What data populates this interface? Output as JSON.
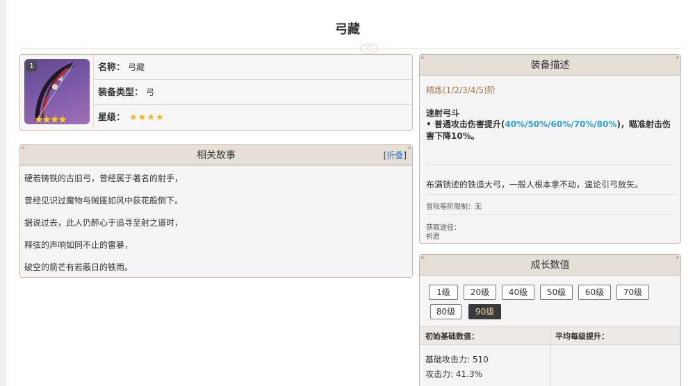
{
  "page": {
    "title": "弓藏"
  },
  "info": {
    "refine_badge": "1",
    "name_label": "名称：",
    "name_value": "弓藏",
    "type_label": "装备类型：",
    "type_value": "弓",
    "rarity_label": "星级：",
    "rarity_stars": "★★★★",
    "rarity_count": 4
  },
  "story": {
    "title": "相关故事",
    "fold_open": "[",
    "fold_link": "折叠",
    "fold_close": "]",
    "lines": [
      "硬若铸铁的古旧弓，曾经属于著名的射手，",
      "曾经见识过魔物与贼匪如风中荻花般倒下。",
      "据说过去，此人仍醉心于追寻至射之道时，",
      "释弦的声响如同不止的雷暴，",
      "破空的箭芒有若蔽日的铁雨。"
    ]
  },
  "description": {
    "title": "装备描述",
    "refine_title": "精炼(1/2/3/4/5)阶",
    "effect_name": "速射弓斗",
    "effect_prefix": "• 普通攻击伤害提升(",
    "effect_highlight": "40%/50%/60%/70%/80%",
    "effect_suffix": ")，瞄准射击伤害下降10%。",
    "flavor": "布满锈迹的铁造大弓，一般人根本拿不动，遑论引弓放矢。",
    "ar_limit": "冒险等阶限制：无",
    "obtain_label": "获取途径：",
    "obtain_value": "祈愿"
  },
  "stats": {
    "title": "成长数值",
    "levels": [
      "1级",
      "20级",
      "40级",
      "50级",
      "60级",
      "70级",
      "80级",
      "90级"
    ],
    "active_level": "90级",
    "col_base": "初始基础数值：",
    "col_growth": "平均每级提升：",
    "base_atk": "基础攻击力: 510",
    "atk_pct": "攻击力: 41.3%"
  },
  "colors": {
    "accent_refine": "#a8774a",
    "highlight": "#2aa2d8",
    "star": "#f2b41a",
    "panel_head": "#e6dfd8"
  }
}
